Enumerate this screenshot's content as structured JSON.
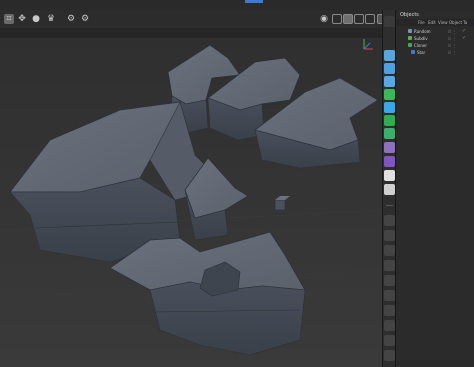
{
  "app": {
    "accent_color": "#3b7bd6",
    "viewport_bg": "#353535"
  },
  "toolbar": {
    "left_icons": [
      "grid-select-icon",
      "move-icon",
      "dot-icon",
      "crown-icon",
      "gear-icon"
    ],
    "right_icons": [
      "target-icon",
      "render-region-icon",
      "render-active-icon",
      "render-settings-icon",
      "picture-viewer-icon",
      "layout-icon"
    ]
  },
  "objects_panel": {
    "title": "Objects",
    "menu": [
      "File",
      "Edit",
      "View",
      "Object",
      "Ta"
    ],
    "rows": [
      {
        "label": "Random",
        "dot_color": "#7f8fa8",
        "flags": "⠿ ⋮",
        "checked": true
      },
      {
        "label": "Subdiv",
        "dot_color": "#5ab04a",
        "flags": "⠿ ⋮",
        "checked": true
      },
      {
        "label": "Cloner",
        "dot_color": "#4aa35a",
        "flags": "⠿ ⋮",
        "checked": false
      },
      {
        "label": "Star",
        "dot_color": "#3b7bd6",
        "flags": "⠿ ⋮",
        "checked": false
      }
    ]
  },
  "side_tools": [
    {
      "name": "cube-icon",
      "color": "#57a6e0"
    },
    {
      "name": "pen-icon",
      "color": "#4fa0e0"
    },
    {
      "name": "text-icon",
      "color": "#58a8e8"
    },
    {
      "name": "sphere-icon",
      "color": "#3ab85a"
    },
    {
      "name": "diamond-icon",
      "color": "#3aa8e8"
    },
    {
      "name": "cloner-icon",
      "color": "#2fae4f"
    },
    {
      "name": "gear-tool-icon",
      "color": "#3aae6a"
    },
    {
      "name": "deformer-icon",
      "color": "#8e6fc0"
    },
    {
      "name": "disc-icon",
      "color": "#7f55c0"
    },
    {
      "name": "light-icon",
      "color": "#e0e0e0"
    },
    {
      "name": "camera-icon",
      "color": "#cfcfcf"
    }
  ]
}
